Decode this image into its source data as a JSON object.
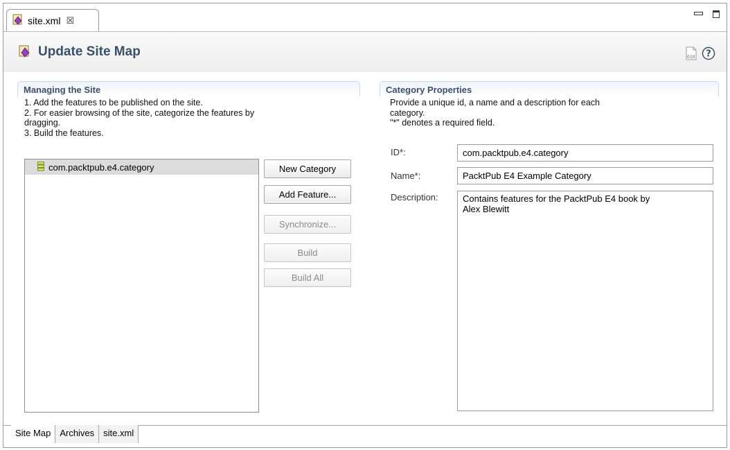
{
  "editor_tab": {
    "title": "site.xml",
    "close_glyph": "☒"
  },
  "header": {
    "title": "Update Site Map",
    "help_glyph": "?"
  },
  "managing": {
    "title": "Managing the Site",
    "lines": [
      "1. Add the features to be published on the site.",
      "2. For easier browsing of the site, categorize the features by",
      "dragging.",
      "3. Build the features."
    ],
    "tree_items": [
      {
        "label": "com.packtpub.e4.category",
        "icon": "category-icon"
      }
    ]
  },
  "buttons": {
    "new_category": "New Category",
    "add_feature": "Add Feature...",
    "synchronize": "Synchronize...",
    "build": "Build",
    "build_all": "Build All"
  },
  "category": {
    "title": "Category Properties",
    "lines": [
      "Provide a unique id, a name and a description for each",
      "category.",
      "\"*\" denotes a required field."
    ],
    "id_label": "ID*:",
    "id_value": "com.packtpub.e4.category",
    "name_label": "Name*:",
    "name_value": "PacktPub E4 Example Category",
    "description_label": "Description:",
    "description_value": "Contains features for the PacktPub E4 book by\nAlex Blewitt"
  },
  "page_tabs": [
    {
      "label": "Site Map",
      "active": true
    },
    {
      "label": "Archives",
      "active": false
    },
    {
      "label": "site.xml",
      "active": false
    }
  ],
  "colors": {
    "section_title": "#3b5067",
    "section_border": "#c9d8ea",
    "selection": "#dcdcdc"
  }
}
